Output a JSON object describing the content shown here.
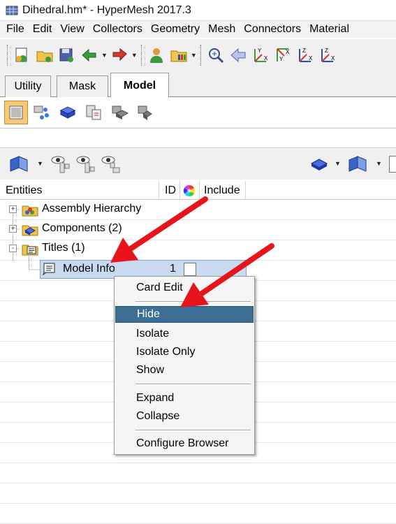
{
  "window": {
    "title": "Dihedral.hm* - HyperMesh 2017.3"
  },
  "menubar": [
    "File",
    "Edit",
    "View",
    "Collectors",
    "Geometry",
    "Mesh",
    "Connectors",
    "Material"
  ],
  "tabs": [
    {
      "label": "Utility",
      "active": false
    },
    {
      "label": "Mask",
      "active": false
    },
    {
      "label": "Model",
      "active": true
    }
  ],
  "toolbar_icons": [
    "new-model-icon",
    "open-model-icon",
    "save-model-icon",
    "import-icon",
    "export-icon",
    "user-profile-icon",
    "results-icon",
    "zoom-icon",
    "previous-view-icon",
    "view-top-icon",
    "view-bottom-icon",
    "view-left-icon",
    "view-right-icon"
  ],
  "browser_header": {
    "entities": "Entities",
    "id": "ID",
    "include": "Include"
  },
  "tree": [
    {
      "label": "Assembly Hierarchy",
      "expander": "+",
      "icon": "assembly-icon"
    },
    {
      "label": "Components (2)",
      "expander": "+",
      "icon": "component-icon"
    },
    {
      "label": "Titles (1)",
      "expander": "-",
      "icon": "title-icon"
    }
  ],
  "selected_item": {
    "label": "Model Info",
    "id": "1"
  },
  "context_menu": {
    "groups": [
      [
        "Card Edit"
      ],
      [
        "Hide",
        "Isolate",
        "Isolate Only",
        "Show"
      ],
      [
        "Expand",
        "Collapse"
      ],
      [
        "Configure Browser"
      ]
    ],
    "highlighted": "Hide"
  },
  "colors": {
    "highlight": "#3d6f94",
    "selection": "#c7daf0",
    "arrow": "#e8141c",
    "active_panel_icon": "#f6c87a"
  }
}
